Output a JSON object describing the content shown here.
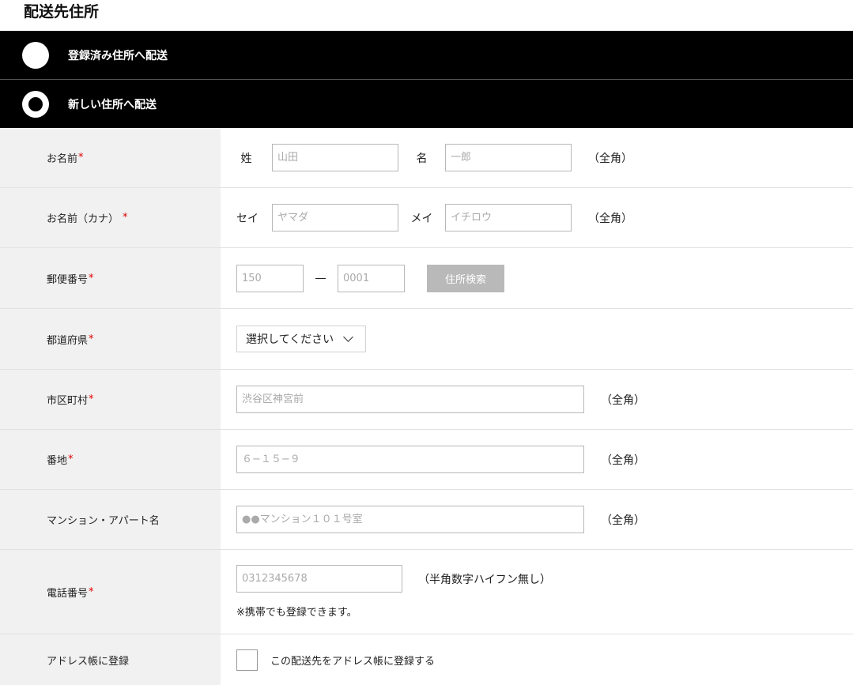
{
  "page": {
    "title": "配送先住所"
  },
  "shipping_options": [
    {
      "label": "登録済み住所へ配送",
      "selected": false
    },
    {
      "label": "新しい住所へ配送",
      "selected": true
    }
  ],
  "required_mark": "*",
  "form": {
    "name": {
      "label": "お名前",
      "last_label": "姓",
      "last_placeholder": "山田",
      "first_label": "名",
      "first_placeholder": "一郎",
      "note": "（全角）"
    },
    "kana": {
      "label": "お名前（カナ）",
      "last_label": "セイ",
      "last_placeholder": "ヤマダ",
      "first_label": "メイ",
      "first_placeholder": "イチロウ",
      "note": "（全角）"
    },
    "postal": {
      "label": "郵便番号",
      "part1_placeholder": "150",
      "part2_placeholder": "0001",
      "search_button": "住所検索"
    },
    "prefecture": {
      "label": "都道府県",
      "selected": "選択してください"
    },
    "city": {
      "label": "市区町村",
      "placeholder": "渋谷区神宮前",
      "note": "（全角）"
    },
    "street": {
      "label": "番地",
      "placeholder": "６−１５−９",
      "note": "（全角）"
    },
    "building": {
      "label": "マンション・アパート名",
      "placeholder": "●●マンション１０１号室",
      "note": "（全角）"
    },
    "phone": {
      "label": "電話番号",
      "placeholder": "0312345678",
      "note": "（半角数字ハイフン無し）",
      "sub_note": "※携帯でも登録できます。"
    },
    "address_book": {
      "label": "アドレス帳に登録",
      "checkbox_label": "この配送先をアドレス帳に登録する",
      "checked": false
    }
  }
}
